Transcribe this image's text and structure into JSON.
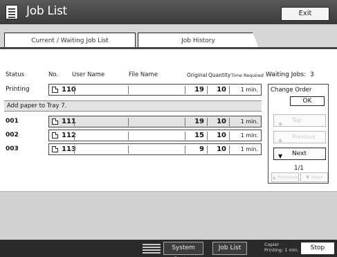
{
  "title": "Job List",
  "exit_label": "Exit",
  "tabs": {
    "current": "Current / Waiting Job List",
    "history": "Job History"
  },
  "columns": {
    "status": "Status",
    "no": "No.",
    "user_name": "User Name",
    "file_name": "File Name",
    "original": "Original",
    "quantity": "Quantity",
    "time_required": "Time Required"
  },
  "waiting_label": "Waiting Jobs:",
  "waiting_count": "3",
  "message": "Add paper to Tray 7.",
  "rows": [
    {
      "status": "Printing",
      "no": "110",
      "original": "19",
      "quantity": "10",
      "time": "1 min."
    },
    {
      "status": "001",
      "no": "111",
      "original": "19",
      "quantity": "10",
      "time": "1 min."
    },
    {
      "status": "002",
      "no": "112",
      "original": "15",
      "quantity": "10",
      "time": "1 min."
    },
    {
      "status": "003",
      "no": "113",
      "original": "9",
      "quantity": "10",
      "time": "1 min."
    }
  ],
  "panel": {
    "change_order": "Change Order",
    "ok": "OK",
    "top": "Top",
    "previous": "Previous",
    "next": "Next",
    "page": "1/1",
    "pg_previous": "Previous",
    "pg_next": "Next"
  },
  "footer": {
    "system_status": "System Status",
    "job_list": "Job List",
    "status_line1": "Copier",
    "status_line2": "Printing: 1 min.",
    "stop_printing": "Stop Printing"
  }
}
